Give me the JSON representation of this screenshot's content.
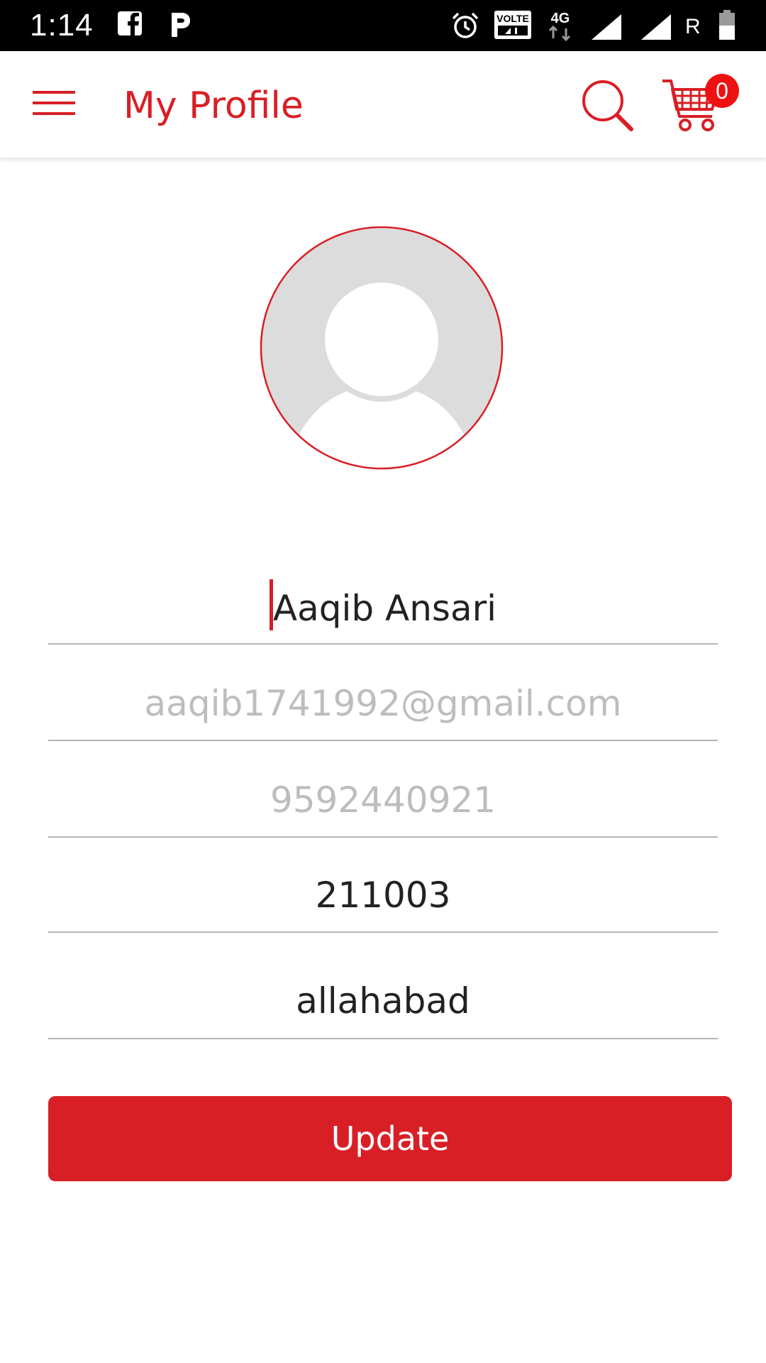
{
  "status_bar": {
    "time": "1:14",
    "icons": [
      "facebook-icon",
      "paytm-icon",
      "alarm-icon",
      "volte-icon",
      "network-4g-icon",
      "signal-icon",
      "signal-icon",
      "battery-icon"
    ],
    "network": "4G",
    "volte": "VOLTE",
    "roaming": "R"
  },
  "app_bar": {
    "title": "My Profile",
    "cart_count": "0"
  },
  "profile": {
    "name": "Aaqib Ansari",
    "email": "aaqib1741992@gmail.com",
    "phone": "9592440921",
    "pincode": "211003",
    "city": "allahabad"
  },
  "actions": {
    "update_label": "Update"
  },
  "colors": {
    "accent": "#d81f26",
    "badge": "#ee1111",
    "avatar_bg": "#dcdcdc",
    "divider": "#b3b3b3",
    "muted_text": "#bdbdbd"
  }
}
